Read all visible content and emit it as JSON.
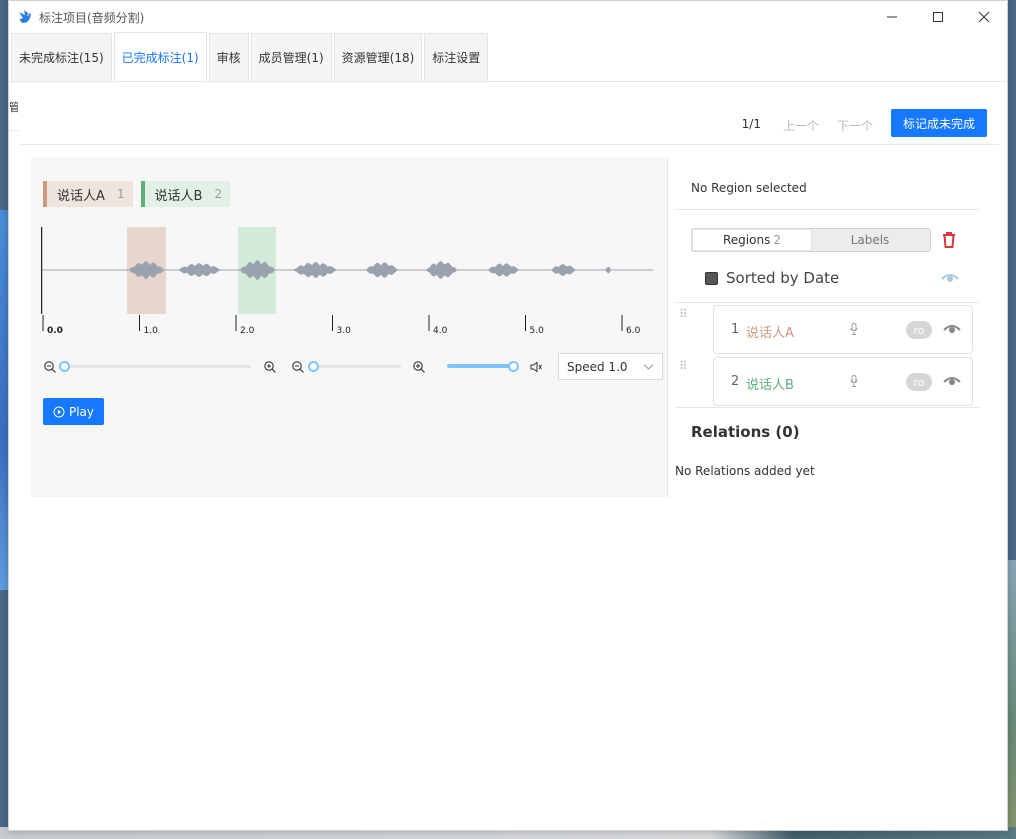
{
  "window": {
    "title": "标注项目(音频分割)",
    "controls": {
      "minimize": "—",
      "maximize": "☐",
      "close": "✕"
    }
  },
  "tabs": [
    {
      "label": "未完成标注(15)",
      "active": false
    },
    {
      "label": "已完成标注(1)",
      "active": true
    },
    {
      "label": "审核",
      "active": false
    },
    {
      "label": "成员管理(1)",
      "active": false
    },
    {
      "label": "资源管理(18)",
      "active": false
    },
    {
      "label": "标注设置",
      "active": false
    }
  ],
  "gutter_text": "管",
  "toolbar": {
    "pager": "1/1",
    "prev_label": "上一个",
    "next_label": "下一个",
    "mark_incomplete_label": "标记成未完成"
  },
  "labels": [
    {
      "name": "说话人A",
      "hotkey": "1",
      "color": "#c99a7e"
    },
    {
      "name": "说话人B",
      "hotkey": "2",
      "color": "#5fb07a"
    }
  ],
  "timeline": {
    "ticks": [
      "0.0",
      "1.0",
      "2.0",
      "3.0",
      "4.0",
      "5.0",
      "6.0"
    ]
  },
  "audio_controls": {
    "speed_label": "Speed 1.0",
    "play_label": "Play"
  },
  "right_panel": {
    "no_region_text": "No Region selected",
    "regions_tab_label": "Regions",
    "regions_count": "2",
    "labels_tab_label": "Labels",
    "sorted_label": "Sorted by Date",
    "regions": [
      {
        "index": "1",
        "label": "说话人A",
        "color": "#c99a7e",
        "badge": "ro"
      },
      {
        "index": "2",
        "label": "说话人B",
        "color": "#5fb07a",
        "badge": "ro"
      }
    ],
    "relations_title": "Relations (0)",
    "relations_empty": "No Relations added yet"
  },
  "colors": {
    "accent": "#1677ff",
    "delete": "#d9363e",
    "waveform": "#9aa3ad",
    "slider": "#7cc5ff"
  }
}
